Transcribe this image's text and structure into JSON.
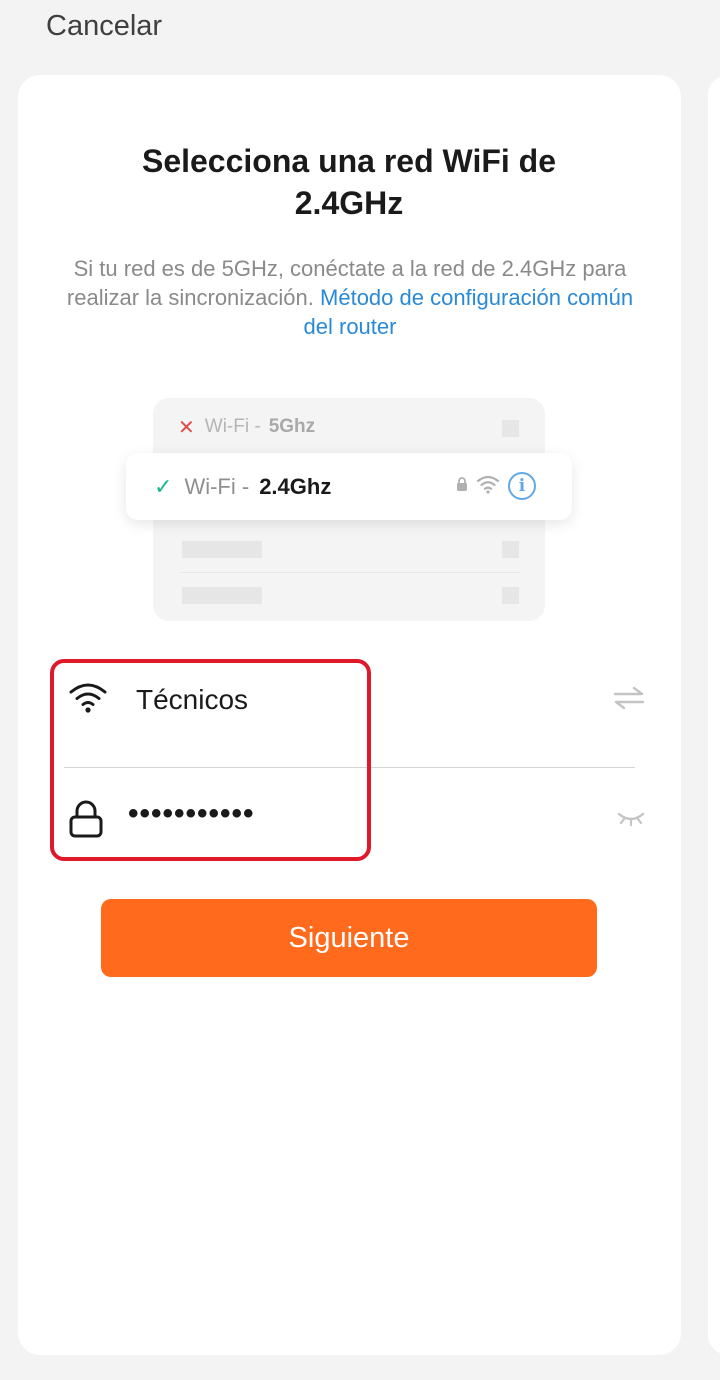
{
  "header": {
    "cancel_label": "Cancelar"
  },
  "content": {
    "title_line1": "Selecciona una red WiFi de",
    "title_line2": "2.4GHz",
    "description_text": "Si tu red es de 5GHz, conéctate a la red de 2.4GHz para realizar la sincronización.",
    "description_link": "Método de configuración común del router"
  },
  "illustration": {
    "row_5g_prefix": "Wi-Fi -",
    "row_5g_band": "5Ghz",
    "row_24_prefix": "Wi-Fi -",
    "row_24_band": "2.4Ghz",
    "icons": [
      "close-icon",
      "check-icon",
      "lock-icon",
      "wifi-icon",
      "info-icon"
    ]
  },
  "form": {
    "ssid_value": "Técnicos",
    "password_masked": "•••••••••••",
    "ssid_icon": "wifi-icon",
    "password_icon": "lock-icon",
    "switch_icon": "swap-arrows-icon",
    "visibility_icon": "eye-closed-icon"
  },
  "actions": {
    "next_label": "Siguiente"
  },
  "colors": {
    "accent": "#ff6a1c",
    "link": "#2a8ad6",
    "highlight": "#e0192a",
    "success": "#18b890",
    "error": "#e44b4b"
  }
}
